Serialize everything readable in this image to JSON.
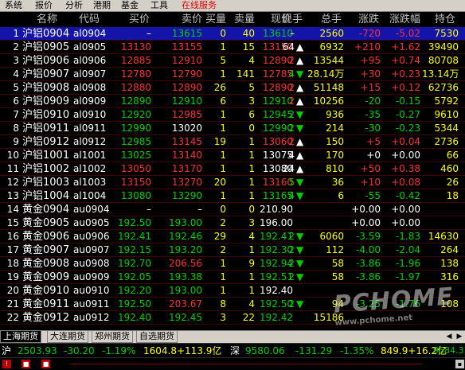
{
  "menu": [
    "系统",
    "报价",
    "分析",
    "港期",
    "基金",
    "工具",
    "在线服务"
  ],
  "columns": [
    "",
    "名称",
    "代码",
    "买价",
    "卖价",
    "买量",
    "卖量",
    "现价",
    "现手",
    "总手",
    "涨跌",
    "涨跌幅",
    "持仓"
  ],
  "colors": {
    "red": "#ff3030",
    "green": "#00d000",
    "white": "#ffffff",
    "yellow": "#ffff00",
    "cyan": "#00e0e0",
    "header": "#c0c0c0",
    "selected_bg": "#1414a8"
  },
  "rows": [
    {
      "no": "1",
      "name": "沪铝0904",
      "code": "al0904",
      "bid": "–",
      "ask": "13615",
      "bidv": "0",
      "askv": "40",
      "last": "13610",
      "vol": "–",
      "dir": "",
      "total": "2560",
      "chg": "-720",
      "pct": "-5.02",
      "oi": "7530",
      "sel": true,
      "cc": {
        "bid": "white",
        "ask": "green",
        "last": "green",
        "chg": "red",
        "pct": "red",
        "oi": "yellow"
      }
    },
    {
      "no": "2",
      "name": "沪铝0905",
      "code": "al0905",
      "bid": "13130",
      "ask": "13155",
      "bidv": "1",
      "askv": "15",
      "last": "13150",
      "vol": "64",
      "dir": "up",
      "total": "6932",
      "chg": "+210",
      "pct": "+1.62",
      "oi": "39490",
      "cc": {
        "bid": "red",
        "ask": "red",
        "last": "red",
        "vol": "white",
        "chg": "red",
        "pct": "red",
        "oi": "yellow"
      }
    },
    {
      "no": "3",
      "name": "沪铝0906",
      "code": "al0906",
      "bid": "12885",
      "ask": "12910",
      "bidv": "5",
      "askv": "4",
      "last": "12890",
      "vol": "2",
      "dir": "up",
      "total": "13544",
      "chg": "+95",
      "pct": "+0.74",
      "oi": "80708",
      "cc": {
        "bid": "red",
        "ask": "red",
        "last": "red",
        "vol": "red",
        "chg": "red",
        "pct": "red",
        "oi": "yellow"
      }
    },
    {
      "no": "4",
      "name": "沪铝0907",
      "code": "al0907",
      "bid": "12780",
      "ask": "12790",
      "bidv": "1",
      "askv": "141",
      "last": "12785",
      "vol": "4",
      "dir": "down",
      "total": "28.14万",
      "chg": "+30",
      "pct": "+0.23",
      "oi": "13.14万",
      "cc": {
        "bid": "red",
        "ask": "red",
        "last": "red",
        "vol": "green",
        "chg": "red",
        "pct": "red",
        "oi": "yellow"
      }
    },
    {
      "no": "5",
      "name": "沪铝0908",
      "code": "al0908",
      "bid": "12880",
      "ask": "12890",
      "bidv": "26",
      "askv": "5",
      "last": "12890",
      "vol": "2",
      "dir": "up",
      "total": "51148",
      "chg": "+15",
      "pct": "+0.12",
      "oi": "62736",
      "cc": {
        "bid": "red",
        "ask": "red",
        "last": "red",
        "vol": "red",
        "chg": "red",
        "pct": "red",
        "oi": "yellow"
      }
    },
    {
      "no": "6",
      "name": "沪铝0909",
      "code": "al0909",
      "bid": "12890",
      "ask": "12910",
      "bidv": "6",
      "askv": "3",
      "last": "12910",
      "vol": "2",
      "dir": "up",
      "total": "10256",
      "chg": "-20",
      "pct": "-0.15",
      "oi": "5792",
      "cc": {
        "bid": "green",
        "ask": "green",
        "last": "green",
        "vol": "red",
        "chg": "green",
        "pct": "green",
        "oi": "yellow"
      }
    },
    {
      "no": "7",
      "name": "沪铝0910",
      "code": "al0910",
      "bid": "12920",
      "ask": "12985",
      "bidv": "1",
      "askv": "6",
      "last": "12945",
      "vol": "2",
      "dir": "down",
      "total": "936",
      "chg": "-35",
      "pct": "-0.27",
      "oi": "9610",
      "cc": {
        "bid": "green",
        "ask": "red",
        "last": "green",
        "vol": "green",
        "chg": "green",
        "pct": "green",
        "oi": "yellow"
      }
    },
    {
      "no": "8",
      "name": "沪铝0911",
      "code": "al0911",
      "bid": "12990",
      "ask": "13020",
      "bidv": "1",
      "askv": "0",
      "last": "12990",
      "vol": "2",
      "dir": "down",
      "total": "214",
      "chg": "-30",
      "pct": "-0.23",
      "oi": "5344",
      "cc": {
        "bid": "green",
        "ask": "white",
        "last": "green",
        "vol": "green",
        "chg": "green",
        "pct": "green",
        "oi": "yellow"
      }
    },
    {
      "no": "9",
      "name": "沪铝0912",
      "code": "al0912",
      "bid": "12985",
      "ask": "13145",
      "bidv": "19",
      "askv": "1",
      "last": "13060",
      "vol": "2",
      "dir": "up",
      "total": "150",
      "chg": "+5",
      "pct": "+0.04",
      "oi": "2736",
      "cc": {
        "bid": "green",
        "ask": "red",
        "last": "red",
        "vol": "red",
        "chg": "red",
        "pct": "red",
        "oi": "yellow"
      }
    },
    {
      "no": "10",
      "name": "沪铝1001",
      "code": "al1001",
      "bid": "13025",
      "ask": "13140",
      "bidv": "1",
      "askv": "1",
      "last": "13075",
      "vol": "4",
      "dir": "up",
      "total": "170",
      "chg": "+0",
      "pct": "+0.00",
      "oi": "66",
      "cc": {
        "bid": "green",
        "ask": "red",
        "last": "white",
        "vol": "white",
        "chg": "white",
        "pct": "white",
        "oi": "yellow"
      }
    },
    {
      "no": "11",
      "name": "沪铝1002",
      "code": "al1002",
      "bid": "13050",
      "ask": "13170",
      "bidv": "1",
      "askv": "1",
      "last": "13080",
      "vol": "24",
      "dir": "up",
      "total": "810",
      "chg": "+50",
      "pct": "+0.38",
      "oi": "460",
      "cc": {
        "bid": "red",
        "ask": "red",
        "last": "white",
        "vol": "white",
        "chg": "red",
        "pct": "red",
        "oi": "yellow"
      }
    },
    {
      "no": "12",
      "name": "沪铝1003",
      "code": "al1003",
      "bid": "13150",
      "ask": "13270",
      "bidv": "20",
      "askv": "1",
      "last": "13160",
      "vol": "5",
      "dir": "down",
      "total": "36",
      "chg": "+10",
      "pct": "+0.08",
      "oi": "26",
      "cc": {
        "bid": "red",
        "ask": "red",
        "last": "red",
        "vol": "green",
        "chg": "red",
        "pct": "red",
        "oi": "yellow"
      }
    },
    {
      "no": "13",
      "name": "沪铝1004",
      "code": "al1004",
      "bid": "13080",
      "ask": "13290",
      "bidv": "1",
      "askv": "1",
      "last": "13165",
      "vol": "4",
      "dir": "down",
      "total": "6",
      "chg": "-55",
      "pct": "-0.42",
      "oi": "18",
      "cc": {
        "bid": "green",
        "ask": "green",
        "last": "green",
        "vol": "green",
        "chg": "green",
        "pct": "green",
        "oi": "yellow"
      }
    },
    {
      "no": "14",
      "name": "黄金0904",
      "code": "au0904",
      "bid": "–",
      "ask": "–",
      "bidv": "0",
      "askv": "0",
      "last": "210.90",
      "vol": "",
      "dir": "",
      "total": "",
      "chg": "+0.00",
      "pct": "+0.00",
      "oi": "",
      "cc": {
        "bid": "white",
        "ask": "white",
        "last": "white",
        "chg": "white",
        "pct": "white",
        "oi": "yellow"
      }
    },
    {
      "no": "15",
      "name": "黄金0905",
      "code": "au0905",
      "bid": "192.50",
      "ask": "193.00",
      "bidv": "2",
      "askv": "3",
      "last": "196.00",
      "vol": "",
      "dir": "",
      "total": "",
      "chg": "+0.00",
      "pct": "+0.00",
      "oi": "",
      "cc": {
        "bid": "green",
        "ask": "green",
        "last": "white",
        "chg": "white",
        "pct": "white",
        "oi": "yellow"
      }
    },
    {
      "no": "16",
      "name": "黄金0906",
      "code": "au0906",
      "bid": "192.41",
      "ask": "192.46",
      "bidv": "29",
      "askv": "4",
      "last": "192.41",
      "vol": "2",
      "dir": "down",
      "total": "6060",
      "chg": "-3.59",
      "pct": "-1.83",
      "oi": "14630",
      "cc": {
        "bid": "green",
        "ask": "green",
        "last": "green",
        "vol": "green",
        "chg": "green",
        "pct": "green",
        "oi": "yellow"
      }
    },
    {
      "no": "17",
      "name": "黄金0907",
      "code": "au0907",
      "bid": "192.15",
      "ask": "193.20",
      "bidv": "2",
      "askv": "1",
      "last": "192.30",
      "vol": "2",
      "dir": "down",
      "total": "112",
      "chg": "-4.00",
      "pct": "-2.04",
      "oi": "264",
      "cc": {
        "bid": "green",
        "ask": "green",
        "last": "green",
        "vol": "green",
        "chg": "green",
        "pct": "green",
        "oi": "yellow"
      }
    },
    {
      "no": "18",
      "name": "黄金0908",
      "code": "au0908",
      "bid": "192.70",
      "ask": "206.56",
      "bidv": "1",
      "askv": "9",
      "last": "192.94",
      "vol": "2",
      "dir": "down",
      "total": "58",
      "chg": "-3.86",
      "pct": "-1.96",
      "oi": "138",
      "cc": {
        "bid": "green",
        "ask": "red",
        "last": "green",
        "vol": "green",
        "chg": "green",
        "pct": "green",
        "oi": "yellow"
      }
    },
    {
      "no": "19",
      "name": "黄金0909",
      "code": "au0909",
      "bid": "192.05",
      "ask": "193.38",
      "bidv": "1",
      "askv": "1",
      "last": "192.51",
      "vol": "2",
      "dir": "down",
      "total": "58",
      "chg": "-3.86",
      "pct": "-1.97",
      "oi": "316",
      "cc": {
        "bid": "green",
        "ask": "green",
        "last": "green",
        "vol": "green",
        "chg": "green",
        "pct": "green",
        "oi": "yellow"
      }
    },
    {
      "no": "20",
      "name": "黄金0910",
      "code": "au0910",
      "bid": "192.20",
      "ask": "193.00",
      "bidv": "1",
      "askv": "1",
      "last": "192.40",
      "vol": "",
      "dir": "",
      "total": "",
      "chg": "",
      "pct": "",
      "oi": "",
      "cc": {
        "bid": "green",
        "ask": "green",
        "last": "white",
        "oi": "yellow"
      }
    },
    {
      "no": "21",
      "name": "黄金0911",
      "code": "au0911",
      "bid": "192.50",
      "ask": "203.67",
      "bidv": "8",
      "askv": "4",
      "last": "192.50",
      "vol": "2",
      "dir": "down",
      "total": "94",
      "chg": "-3.25",
      "pct": "-1.76",
      "oi": "108",
      "cc": {
        "bid": "green",
        "ask": "red",
        "last": "green",
        "vol": "green",
        "chg": "green",
        "pct": "green",
        "oi": "yellow"
      }
    },
    {
      "no": "22",
      "name": "黄金0912",
      "code": "au0912",
      "bid": "192.40",
      "ask": "192.45",
      "bidv": "3",
      "askv": "22",
      "last": "192.42",
      "vol": "",
      "dir": "",
      "total": "15186",
      "chg": "",
      "pct": "",
      "oi": "",
      "cc": {
        "bid": "green",
        "ask": "green",
        "last": "green",
        "oi": "yellow"
      }
    }
  ],
  "tabs": [
    "上海期货",
    "大连期货",
    "郑州期货",
    "自选期货"
  ],
  "ticker": {
    "sh_label": "沪",
    "sh_index": "2503.93",
    "sh_chg": "-30.20",
    "sh_pct": "-1.19%",
    "sh_amount": "1604.8+113.9亿",
    "sz_label": "深",
    "sz_index": "9580.06",
    "sz_chg": "-131.29",
    "sz_pct": "-1.35%",
    "sz_amount": "849.9+16.2亿",
    "extra": "9584.3"
  },
  "watermark": {
    "brand": "PCHOME",
    "sub": "www.pchome.net"
  }
}
